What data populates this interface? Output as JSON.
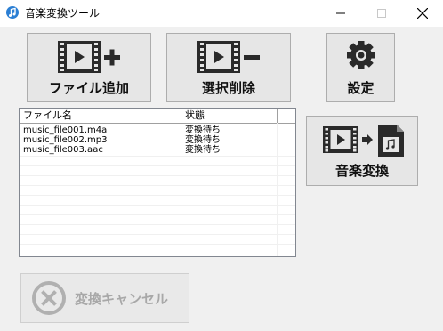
{
  "window": {
    "title": "音楽変換ツール"
  },
  "toolbar": {
    "add_file_label": "ファイル追加",
    "remove_selected_label": "選択削除",
    "settings_label": "設定",
    "convert_label": "音楽変換",
    "cancel_label": "変換キャンセル"
  },
  "file_list": {
    "columns": [
      "ファイル名",
      "状態"
    ],
    "rows": [
      {
        "name": "music_file001.m4a",
        "status": "変換待ち"
      },
      {
        "name": "music_file002.mp3",
        "status": "変換待ち"
      },
      {
        "name": "music_file003.aac",
        "status": "変換待ち"
      }
    ]
  },
  "icons": {
    "app": "music-note-icon",
    "add": "film-plus-icon",
    "remove": "film-minus-icon",
    "settings": "gear-icon",
    "convert": "film-to-music-file-icon",
    "cancel": "cancel-x-icon"
  }
}
